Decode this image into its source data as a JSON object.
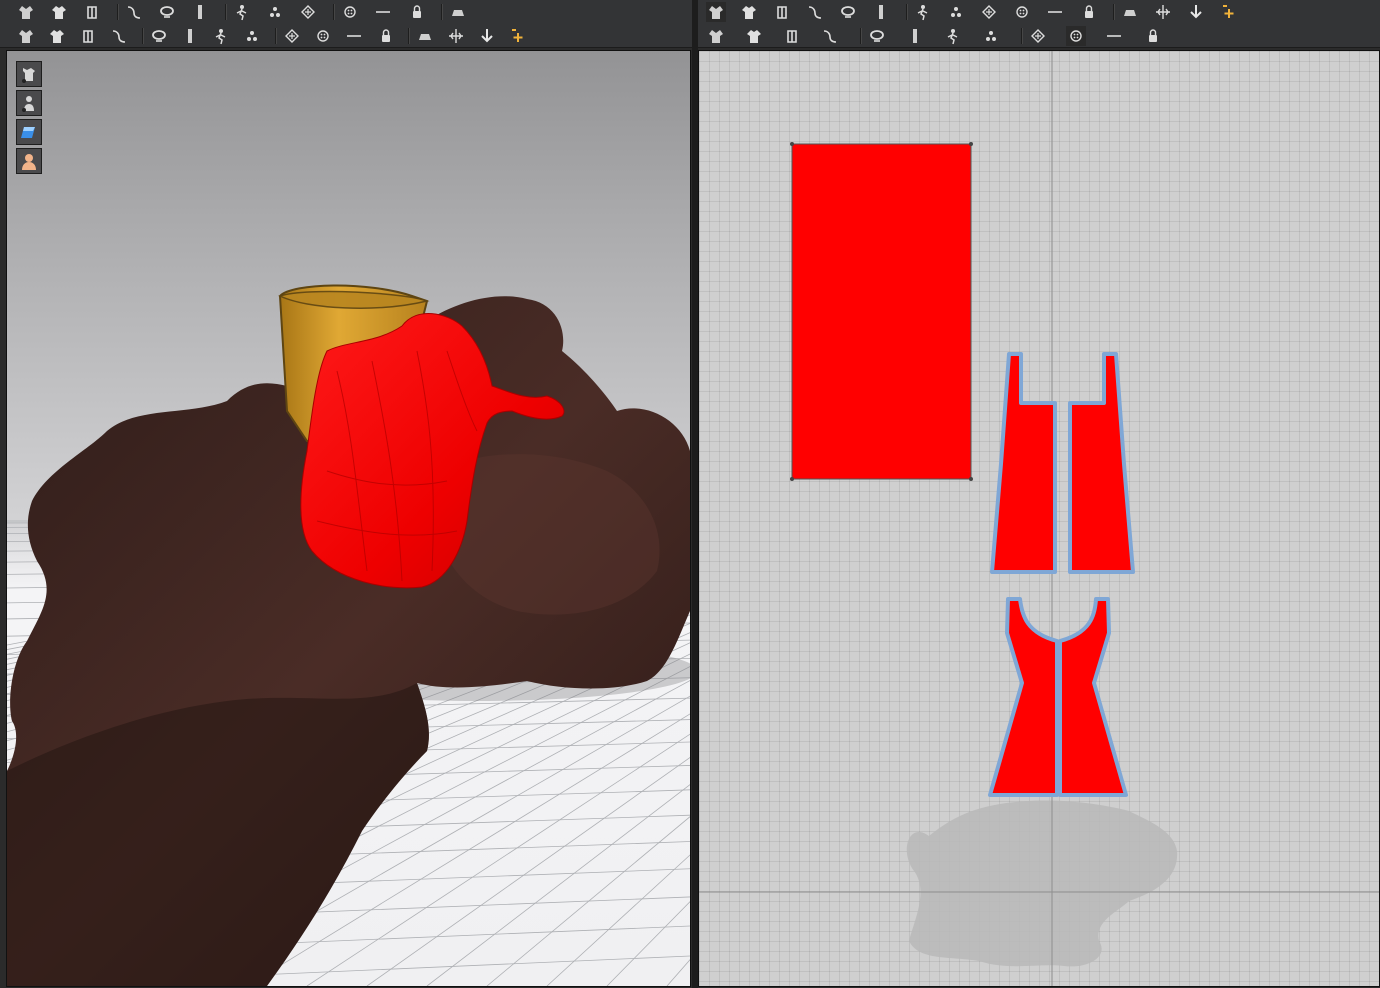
{
  "toolbar_3d": {
    "row1": [
      {
        "icon": "download-arrow-icon"
      },
      {
        "icon": "move-plus-icon"
      },
      {
        "icon": "select-box-icon"
      },
      {
        "icon": "transform-box-icon"
      },
      {
        "icon": "fold-icon"
      },
      {
        "icon": "pin-line-icon"
      },
      {
        "icon": "pin-scatter-icon"
      },
      {
        "icon": "garment-tack-icon"
      },
      {
        "icon": "shirt-front-icon"
      },
      {
        "icon": "shirt-back-icon"
      },
      {
        "icon": "seam-line-icon"
      },
      {
        "icon": "loop-icon"
      },
      {
        "icon": "ruler-icon"
      }
    ],
    "row2": [
      {
        "icon": "avatar-walk-icon"
      },
      {
        "icon": "pin-tool-icon"
      },
      {
        "icon": "steam-icon"
      },
      {
        "icon": "arrangement-icon"
      },
      {
        "icon": "point-grid-icon"
      },
      {
        "icon": "diamond-grid-icon"
      },
      {
        "icon": "button-add-icon"
      },
      {
        "icon": "button-icon"
      },
      {
        "icon": "zipper-line-icon"
      },
      {
        "icon": "lock-icon"
      },
      {
        "icon": "flat-iron-icon"
      },
      {
        "icon": "fabric-surface-icon"
      },
      {
        "icon": "measure-cross-icon"
      },
      {
        "icon": "shirt-sim-icon"
      },
      {
        "icon": "shirt-fit-icon"
      },
      {
        "icon": "scene-screenshot-icon"
      }
    ]
  },
  "toolbar_2d": {
    "row1": [
      {
        "icon": "edit-pattern-icon",
        "active": true
      },
      {
        "icon": "edit-points-icon"
      },
      {
        "icon": "curve-point-icon"
      },
      {
        "icon": "edit-curvature-icon"
      },
      {
        "icon": "add-point-icon"
      },
      {
        "icon": "segment-edit-icon"
      },
      {
        "icon": "polygon-icon"
      },
      {
        "icon": "rectangle-icon"
      },
      {
        "icon": "circle-icon"
      },
      {
        "icon": "internal-polygon-icon"
      },
      {
        "icon": "internal-rectangle-icon"
      },
      {
        "icon": "internal-circle-icon"
      },
      {
        "icon": "dart-icon"
      },
      {
        "icon": "trace-icon"
      },
      {
        "icon": "pleat-icon"
      },
      {
        "icon": "fold-arrange-icon"
      }
    ],
    "row2": [
      {
        "icon": "segment-sew-icon"
      },
      {
        "icon": "free-sew-icon"
      },
      {
        "icon": "multi-sew-icon"
      },
      {
        "icon": "edit-sewing-icon"
      },
      {
        "icon": "iron-icon"
      },
      {
        "icon": "shirt-pattern-icon"
      },
      {
        "icon": "arrangement-2d-icon"
      },
      {
        "icon": "point-grid-2d-icon"
      },
      {
        "icon": "diamond-grid-2d-icon"
      },
      {
        "icon": "pin-dot-icon",
        "active": true
      },
      {
        "icon": "texture-edit-icon"
      },
      {
        "icon": "texture-transform-icon"
      }
    ]
  },
  "viewport_3d": {
    "side_buttons": [
      {
        "icon": "show-garment-icon"
      },
      {
        "icon": "show-avatar-icon"
      },
      {
        "icon": "texture-view-icon"
      },
      {
        "icon": "avatar-skin-icon"
      }
    ],
    "colors": {
      "avatar": "#3a2420",
      "garment": "#ff0000",
      "cylinder": "#d09a2a",
      "floor": "#f3f3f5"
    }
  },
  "viewport_2d": {
    "pattern_pieces": [
      {
        "kind": "rectangle-panel"
      },
      {
        "kind": "front-left-panel"
      },
      {
        "kind": "front-right-panel"
      },
      {
        "kind": "back-left-panel"
      },
      {
        "kind": "back-right-panel"
      }
    ],
    "colors": {
      "piece_fill": "#ff0000",
      "seam_outline": "#7fa7d6",
      "board": "#cfcfcf"
    }
  }
}
